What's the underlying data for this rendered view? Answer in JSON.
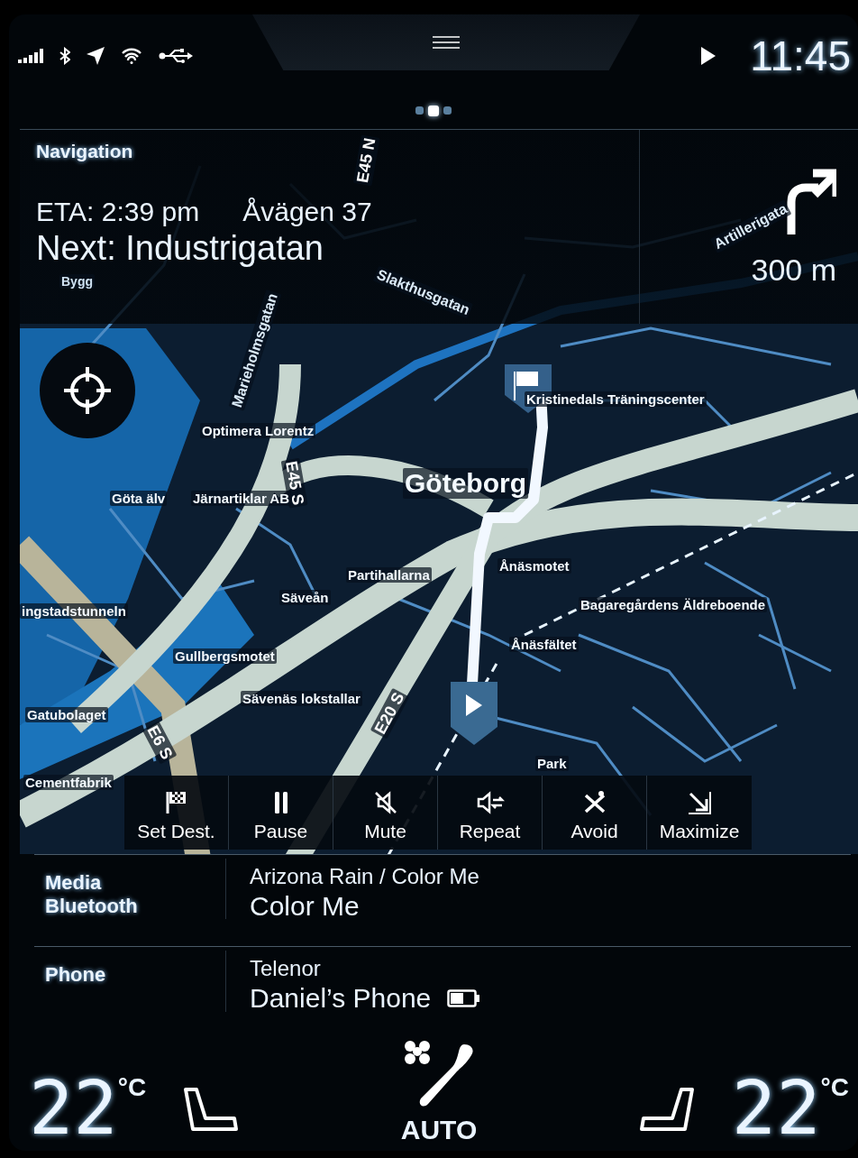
{
  "status_bar": {
    "time": "11:45"
  },
  "page_dots": [
    {
      "selected": false
    },
    {
      "selected": true
    },
    {
      "selected": false
    }
  ],
  "navigation": {
    "title": "Navigation",
    "eta": "ETA: 2:39 pm",
    "street": "Åvägen 37",
    "next": "Next: Industrigatan",
    "turn_distance": "300 m",
    "map_labels": [
      {
        "text": "Bygg",
        "kind": "small"
      },
      {
        "text": "Slakthusgatan",
        "kind": "street"
      },
      {
        "text": "Artillerigata",
        "kind": "street"
      },
      {
        "text": "E45 N",
        "kind": "road"
      },
      {
        "text": "Marieholmsgatan",
        "kind": "street"
      },
      {
        "text": "E45 S",
        "kind": "road"
      },
      {
        "text": "Optimera Lorentz",
        "kind": "place"
      },
      {
        "text": "Göta älv",
        "kind": "place"
      },
      {
        "text": "Järnartiklar AB",
        "kind": "place"
      },
      {
        "text": "Göteborg",
        "kind": "city"
      },
      {
        "text": "Kristinedals Träningscenter",
        "kind": "place"
      },
      {
        "text": "Partihallarna",
        "kind": "place"
      },
      {
        "text": "Säveån",
        "kind": "place"
      },
      {
        "text": "Ånäsmotet",
        "kind": "place"
      },
      {
        "text": "Bagaregårdens Äldreboende",
        "kind": "place"
      },
      {
        "text": "Ånäsfältet",
        "kind": "place"
      },
      {
        "text": "ingstadstunneln",
        "kind": "place"
      },
      {
        "text": "Gullbergsmotet",
        "kind": "place"
      },
      {
        "text": "Gatubolaget",
        "kind": "place"
      },
      {
        "text": "E6 S",
        "kind": "road"
      },
      {
        "text": "Sävenäs lokstallar",
        "kind": "place"
      },
      {
        "text": "E20 S",
        "kind": "road"
      },
      {
        "text": "Cementfabrik",
        "kind": "place"
      },
      {
        "text": "Park",
        "kind": "place"
      }
    ],
    "actions": [
      {
        "label": "Set Dest.",
        "kind": "flag"
      },
      {
        "label": "Pause",
        "kind": "pause"
      },
      {
        "label": "Mute",
        "kind": "mute"
      },
      {
        "label": "Repeat",
        "kind": "repeat"
      },
      {
        "label": "Avoid",
        "kind": "avoid"
      },
      {
        "label": "Maximize",
        "kind": "maximize"
      }
    ]
  },
  "media": {
    "source": "Media",
    "subsource": "Bluetooth",
    "track": "Arizona Rain / Color Me",
    "title": "Color Me"
  },
  "phone": {
    "label": "Phone",
    "carrier": "Telenor",
    "device": "Daniel’s Phone"
  },
  "climate": {
    "left_temp": "22",
    "left_unit": "°C",
    "mode": "AUTO",
    "right_temp": "22",
    "right_unit": "°C"
  }
}
